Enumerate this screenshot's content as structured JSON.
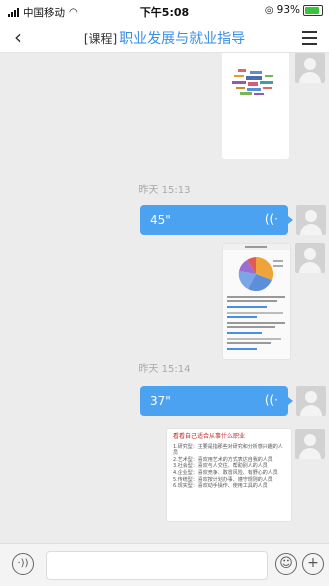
{
  "status_bar": {
    "carrier": "中国移动",
    "time": "下午5:08",
    "battery": "93%"
  },
  "header": {
    "back_icon": "chevron-left-icon",
    "tag": "[课程]",
    "title": "职业发展与就业指导",
    "menu_icon": "hamburger-menu-icon"
  },
  "messages": {
    "time_1": "昨天 15:13",
    "voice_1": "45\"",
    "time_2": "昨天 15:14",
    "voice_2": "37\""
  },
  "doc_card": {
    "title": "看看自己适合从事什么职业",
    "lines": [
      "1.研究型：主要是指那些对研究和分析感兴趣的人员",
      "2.艺术型：喜欢用艺术的方式表达自我的人员",
      "3.社会型：喜欢与人交往、帮助别人的人员",
      "4.企业型：喜欢竞争、敢冒风险、有野心的人员",
      "5.传统型：喜欢按计划办事、遵守规则的人员",
      "6.现实型：喜欢动手操作、使用工具的人员"
    ]
  },
  "colors": {
    "accent": "#3a8ee6",
    "bubble": "#4aa2f0",
    "background": "#ececec"
  },
  "input_bar": {
    "voice_icon": "voice-input-icon",
    "emoji_icon": "emoji-icon",
    "plus_icon": "plus-icon"
  }
}
